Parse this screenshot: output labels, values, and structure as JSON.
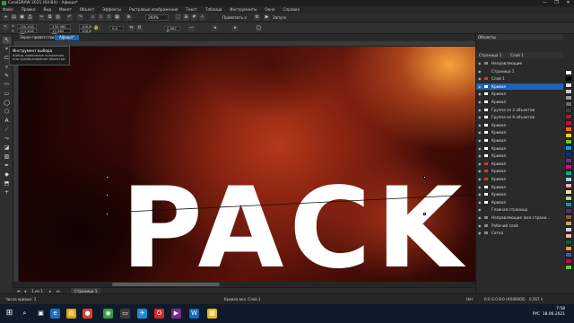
{
  "window": {
    "title": "CorelDRAW 2021 (64-Bit) - Афиша*",
    "controls": [
      "—",
      "❐",
      "✕"
    ]
  },
  "menu": [
    "Файл",
    "Правка",
    "Вид",
    "Макет",
    "Объект",
    "Эффекты",
    "Растровые изображения",
    "Текст",
    "Таблица",
    "Инструменты",
    "Окно",
    "Справка"
  ],
  "toolbar": {
    "zoom_value": "260%",
    "snap_label": "Привязать к",
    "launch_label": "Запуск"
  },
  "propbar": {
    "x": "150,918 мм",
    "y": "114,616 мм",
    "w": "230,960 мм",
    "h": "12,963 мм",
    "sx": "100,0",
    "sy": "100,0",
    "angle": "0,0",
    "outline": "0,567 п"
  },
  "doc_tabs": [
    {
      "label": "Экран приветствия",
      "active": false
    },
    {
      "label": "Афиша*",
      "active": true
    }
  ],
  "tooltip": {
    "title": "Инструмент выбора",
    "body": "Выбор, изменение положения или преобразование объектов."
  },
  "canvas": {
    "headline": "PACK"
  },
  "page_nav": {
    "counter": "1 из 1",
    "page_tab": "Страница 1"
  },
  "docker": {
    "title": "Объекты",
    "header_page": "Страница 1",
    "header_layer": "Слой 1",
    "rows": [
      {
        "label": "Направляющие",
        "color": "#888888",
        "selected": false
      },
      {
        "label": "Страница 1",
        "color": "",
        "selected": false
      },
      {
        "label": "Слой 1",
        "color": "#d33b2c",
        "selected": false
      },
      {
        "label": "Кривая",
        "color": "#ffffff",
        "selected": true
      },
      {
        "label": "Кривая",
        "color": "#ffffff",
        "selected": false
      },
      {
        "label": "Кривая",
        "color": "#ffffff",
        "selected": false
      },
      {
        "label": "Группа из 2 объектов",
        "color": "#ffffff",
        "selected": false
      },
      {
        "label": "Группа из 6 объектов",
        "color": "#ffffff",
        "selected": false
      },
      {
        "label": "Кривая",
        "color": "#ffffff",
        "selected": false
      },
      {
        "label": "Кривая",
        "color": "#ffffff",
        "selected": false
      },
      {
        "label": "Кривая",
        "color": "#ffffff",
        "selected": false
      },
      {
        "label": "Кривая",
        "color": "#ffffff",
        "selected": false
      },
      {
        "label": "Кривая",
        "color": "#ffffff",
        "selected": false
      },
      {
        "label": "Кривая",
        "color": "#d33b2c",
        "selected": false
      },
      {
        "label": "Кривая",
        "color": "#d33b2c",
        "selected": false
      },
      {
        "label": "Кривая",
        "color": "#d33b2c",
        "selected": false
      },
      {
        "label": "Кривая",
        "color": "#ffffff",
        "selected": false
      },
      {
        "label": "Кривая",
        "color": "#ffffff",
        "selected": false
      },
      {
        "label": "Кривая",
        "color": "#ffffff",
        "selected": false
      },
      {
        "label": "Главная страница",
        "color": "",
        "selected": false
      },
      {
        "label": "Направляющие (все страни...",
        "color": "#888888",
        "selected": false
      },
      {
        "label": "Рабочий слой",
        "color": "#888888",
        "selected": false
      },
      {
        "label": "Сетка",
        "color": "#888888",
        "selected": false
      }
    ]
  },
  "palette": [
    "#ffffff",
    "#000000",
    "#e6e6e6",
    "#c8c8c8",
    "#9a9a9a",
    "#6b6b6b",
    "#3d3d3d",
    "#c8102e",
    "#e4002b",
    "#ff6a13",
    "#ffd100",
    "#78be20",
    "#00a3e0",
    "#0033a0",
    "#7a2a90",
    "#e10098",
    "#00b388",
    "#a0d3e8",
    "#f4a6c6",
    "#ffe08a",
    "#b4d98a",
    "#009ca6",
    "#5b2c6f",
    "#8b5e3c",
    "#c9a36b",
    "#d0d0ff",
    "#ffb3a7",
    "#006341",
    "#ff9e1b",
    "#3a5dae",
    "#bf0d3e",
    "#66cc33"
  ],
  "status": {
    "left": "Числа кривых: 2",
    "layer": "Кривая вкл. Слой 1",
    "fill_label": "Нет",
    "coords": "R:0 G:0 B:0 (#000000)",
    "outline_w": "0,567 п"
  },
  "taskbar": {
    "time": "7:58",
    "date": "18.06.2021",
    "lang": "РУС"
  }
}
